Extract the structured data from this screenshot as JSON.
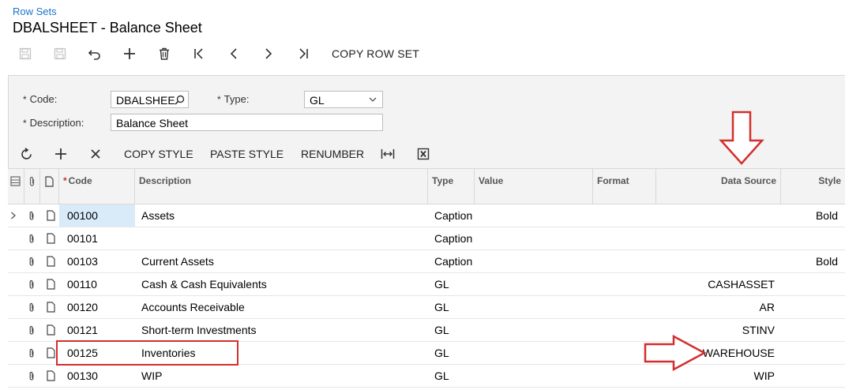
{
  "breadcrumb": "Row Sets",
  "title": "DBALSHEET - Balance Sheet",
  "toolbar": {
    "copy_row_set": "COPY ROW SET"
  },
  "form": {
    "code_label": "Code:",
    "code_value": "DBALSHEE",
    "type_label": "Type:",
    "type_value": "GL",
    "description_label": "Description:",
    "description_value": "Balance Sheet",
    "required_mark": "*"
  },
  "grid_toolbar": {
    "copy_style": "COPY STYLE",
    "paste_style": "PASTE STYLE",
    "renumber": "RENUMBER"
  },
  "columns": {
    "code": "Code",
    "description": "Description",
    "type": "Type",
    "value": "Value",
    "format": "Format",
    "data_source": "Data Source",
    "style": "Style",
    "required_mark": "*"
  },
  "rows": [
    {
      "code": "00100",
      "description": "Assets",
      "type": "Caption",
      "data_source": "",
      "style": "Bold"
    },
    {
      "code": "00101",
      "description": "",
      "type": "Caption",
      "data_source": "",
      "style": ""
    },
    {
      "code": "00103",
      "description": "Current Assets",
      "type": "Caption",
      "data_source": "",
      "style": "Bold"
    },
    {
      "code": "00110",
      "description": "Cash & Cash Equivalents",
      "type": "GL",
      "data_source": "CASHASSET",
      "style": ""
    },
    {
      "code": "00120",
      "description": "Accounts Receivable",
      "type": "GL",
      "data_source": "AR",
      "style": ""
    },
    {
      "code": "00121",
      "description": "Short-term Investments",
      "type": "GL",
      "data_source": "STINV",
      "style": ""
    },
    {
      "code": "00125",
      "description": "Inventories",
      "type": "GL",
      "data_source": "WAREHOUSE",
      "style": ""
    },
    {
      "code": "00130",
      "description": "WIP",
      "type": "GL",
      "data_source": "WIP",
      "style": ""
    }
  ],
  "colors": {
    "link": "#1a73c8",
    "annotation": "#d32f2f",
    "selected_cell": "#d9ebf9"
  }
}
